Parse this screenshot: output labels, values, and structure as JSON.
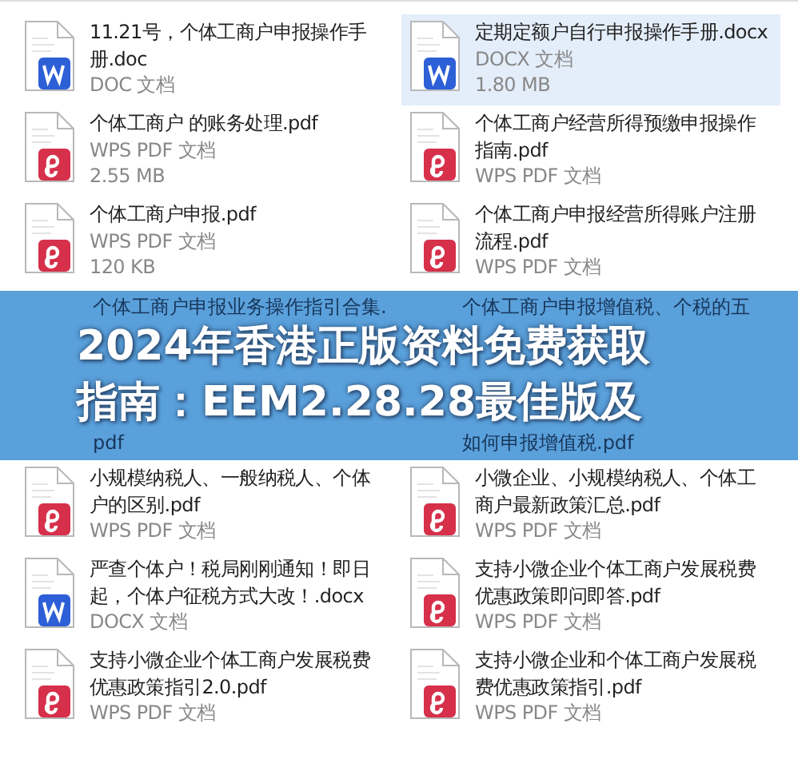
{
  "files": [
    {
      "kind": "word",
      "name": "11.21号，个体工商户申报操作手册.doc",
      "type": "DOC 文档",
      "selected": false
    },
    {
      "kind": "word",
      "name": "定期定额户自行申报操作手册.docx",
      "type": "DOCX 文档",
      "size": "1.80 MB",
      "selected": true
    },
    {
      "kind": "pdf",
      "name": "个体工商户 的账务处理.pdf",
      "type": "WPS PDF 文档",
      "size": "2.55 MB",
      "selected": false
    },
    {
      "kind": "pdf",
      "name": "个体工商户经营所得预缴申报操作指南.pdf",
      "type": "WPS PDF 文档",
      "selected": false
    },
    {
      "kind": "pdf",
      "name": "个体工商户申报.pdf",
      "type": "WPS PDF 文档",
      "size": "120 KB",
      "selected": false
    },
    {
      "kind": "pdf",
      "name": "个体工商户申报经营所得账户注册流程.pdf",
      "type": "WPS PDF 文档",
      "selected": false
    },
    {
      "kind": "pdf",
      "name": "小规模纳税人、一般纳税人、个体户的区别.pdf",
      "type": "WPS PDF 文档",
      "selected": false
    },
    {
      "kind": "pdf",
      "name": "小微企业、小规模纳税人、个体工商户最新政策汇总.pdf",
      "type": "WPS PDF 文档",
      "selected": false
    },
    {
      "kind": "word",
      "name": "严查个体户！税局刚刚通知！即日起，个体户征税方式大改！.docx",
      "type": "DOCX 文档",
      "selected": false
    },
    {
      "kind": "pdf",
      "name": "支持小微企业个体工商户发展税费优惠政策即问即答.pdf",
      "type": "WPS PDF 文档",
      "selected": false
    },
    {
      "kind": "pdf",
      "name": "支持小微企业个体工商户发展税费优惠政策指引2.0.pdf",
      "type": "WPS PDF 文档",
      "selected": false
    },
    {
      "kind": "pdf",
      "name": "支持小微企业和个体工商户发展税费优惠政策指引.pdf",
      "type": "WPS PDF 文档",
      "selected": false
    }
  ],
  "banner": {
    "names_above": [
      "个体工商户申报业务操作指引合集.",
      "个体工商户申报增值税、个税的五"
    ],
    "lines": [
      "2024年香港正版资料免费获取",
      "指南：EEM2.28.28最佳版及"
    ],
    "names_below": [
      "pdf",
      "如何申报增值税.pdf"
    ]
  }
}
